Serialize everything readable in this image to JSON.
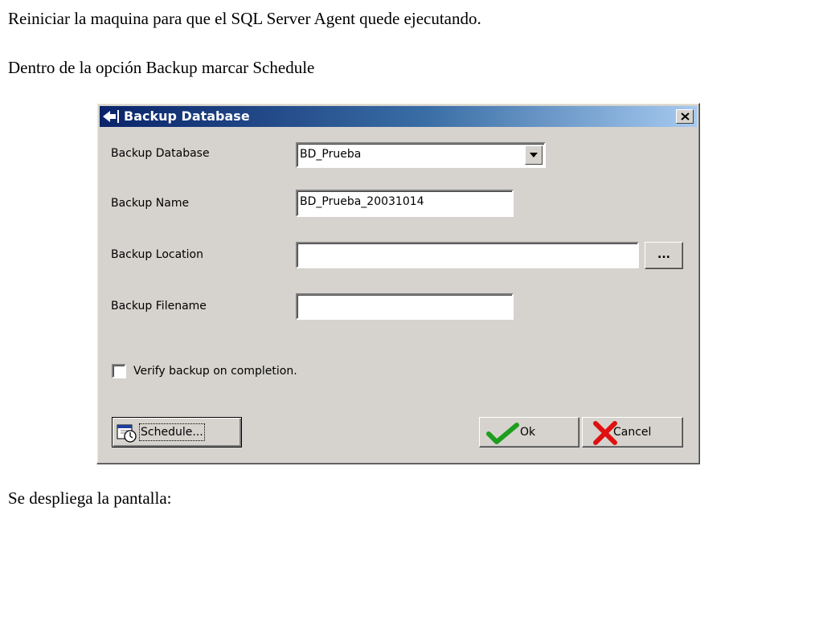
{
  "slide": {
    "line1": "Reiniciar la maquina para que el SQL Server Agent quede ejecutando.",
    "line2": "Dentro de la opción Backup marcar Schedule",
    "line3": "Se despliega la pantalla:"
  },
  "dialog": {
    "title": "Backup Database",
    "fields": {
      "database_label": "Backup Database",
      "database_value": "BD_Prueba",
      "name_label": "Backup Name",
      "name_value": "BD_Prueba_20031014",
      "location_label": "Backup Location",
      "location_value": "",
      "browse_label": "...",
      "filename_label": "Backup Filename",
      "filename_value": ""
    },
    "verify": {
      "label": "Verify backup on completion.",
      "checked": false
    },
    "buttons": {
      "schedule": "Schedule...",
      "ok": "Ok",
      "cancel": "Cancel"
    }
  },
  "colors": {
    "titlebar_start": "#0a246a",
    "titlebar_end": "#a6caf0",
    "dialog_face": "#d6d3ce",
    "ok_check": "#1e9e1e",
    "cancel_x": "#e01010"
  },
  "icons": {
    "title": "back-arrow-icon",
    "close": "close-icon",
    "combo": "dropdown-arrow-icon",
    "schedule": "calendar-clock-icon",
    "ok": "checkmark-icon",
    "cancel": "red-x-icon"
  }
}
